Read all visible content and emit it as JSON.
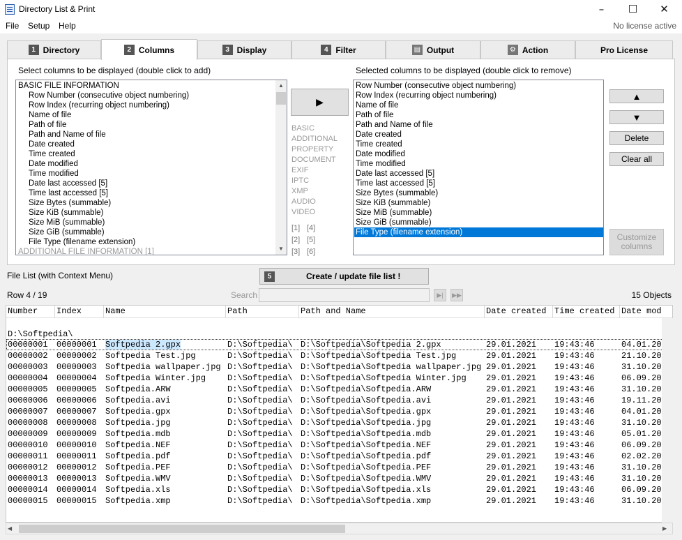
{
  "window": {
    "title": "Directory List & Print",
    "minimize": "–",
    "maximize": "☐",
    "close": "✕"
  },
  "menu": {
    "items": [
      "File",
      "Setup",
      "Help"
    ],
    "license_status": "No license active"
  },
  "tabs": [
    {
      "num": "1",
      "label": "Directory",
      "icon": "number-badge"
    },
    {
      "num": "2",
      "label": "Columns",
      "icon": "number-badge"
    },
    {
      "num": "3",
      "label": "Display",
      "icon": "number-badge"
    },
    {
      "num": "4",
      "label": "Filter",
      "icon": "number-badge"
    },
    {
      "num": "▤",
      "label": "Output",
      "icon": "output-icon"
    },
    {
      "num": "⚙",
      "label": "Action",
      "icon": "gear-icon"
    },
    {
      "num": "",
      "label": "Pro License",
      "icon": ""
    }
  ],
  "columns": {
    "available_caption": "Select columns to be displayed (double click to add)",
    "selected_caption": "Selected columns to be displayed (double click to remove)",
    "available": [
      {
        "text": "BASIC FILE INFORMATION",
        "type": "header"
      },
      {
        "text": "Row Number  (consecutive object numbering)",
        "type": "item"
      },
      {
        "text": "Row Index  (recurring object numbering)",
        "type": "item"
      },
      {
        "text": "Name of file",
        "type": "item"
      },
      {
        "text": "Path of file",
        "type": "item"
      },
      {
        "text": "Path and Name of file",
        "type": "item"
      },
      {
        "text": "Date created",
        "type": "item"
      },
      {
        "text": "Time created",
        "type": "item"
      },
      {
        "text": "Date modified",
        "type": "item"
      },
      {
        "text": "Time modified",
        "type": "item"
      },
      {
        "text": "Date last accessed [5]",
        "type": "item"
      },
      {
        "text": "Time last accessed [5]",
        "type": "item"
      },
      {
        "text": "Size Bytes  (summable)",
        "type": "item"
      },
      {
        "text": "Size KiB  (summable)",
        "type": "item"
      },
      {
        "text": "Size MiB  (summable)",
        "type": "item"
      },
      {
        "text": "Size GiB  (summable)",
        "type": "item"
      },
      {
        "text": "File Type  (filename extension)",
        "type": "item"
      },
      {
        "text": "ADDITIONAL FILE INFORMATION [1]",
        "type": "dim"
      }
    ],
    "selected": [
      "Row Number  (consecutive object numbering)",
      "Row Index  (recurring object numbering)",
      "Name of file",
      "Path of file",
      "Path and Name of file",
      "Date created",
      "Time created",
      "Date modified",
      "Time modified",
      "Date last accessed [5]",
      "Time last accessed [5]",
      "Size Bytes  (summable)",
      "Size KiB  (summable)",
      "Size MiB  (summable)",
      "Size GiB  (summable)",
      "File Type  (filename extension)"
    ],
    "selected_index": 15,
    "add_button": "▶",
    "categories": [
      "BASIC",
      "ADDITIONAL",
      "PROPERTY",
      "DOCUMENT",
      "EXIF",
      "IPTC",
      "XMP",
      "AUDIO",
      "VIDEO"
    ],
    "page_refs": [
      [
        "[1]",
        "[4]"
      ],
      [
        "[2]",
        "[5]"
      ],
      [
        "[3]",
        "[6]"
      ]
    ],
    "up_button": "▲",
    "down_button": "▼",
    "delete_button": "Delete",
    "clear_button": "Clear all",
    "customize_button": "Customize columns"
  },
  "file_list": {
    "caption": "File List (with Context Menu)",
    "create_num": "5",
    "create_button": "Create / update file list !",
    "row_status": "Row 4 / 19",
    "search_label": "Search",
    "search_value": "",
    "objects_count": "15 Objects",
    "headers": [
      "Number",
      "Index",
      "Name",
      "Path",
      "Path and Name",
      "Date created",
      "Time created",
      "Date mod"
    ],
    "group_label": "D:\\Softpedia\\",
    "current_row": 0,
    "rows": [
      [
        "00000001",
        "00000001",
        "Softpedia 2.gpx",
        "D:\\Softpedia\\",
        "D:\\Softpedia\\Softpedia 2.gpx",
        "29.01.2021",
        "19:43:46",
        "04.01.20"
      ],
      [
        "00000002",
        "00000002",
        "Softpedia Test.jpg",
        "D:\\Softpedia\\",
        "D:\\Softpedia\\Softpedia Test.jpg",
        "29.01.2021",
        "19:43:46",
        "21.10.20"
      ],
      [
        "00000003",
        "00000003",
        "Softpedia wallpaper.jpg",
        "D:\\Softpedia\\",
        "D:\\Softpedia\\Softpedia wallpaper.jpg",
        "29.01.2021",
        "19:43:46",
        "31.10.20"
      ],
      [
        "00000004",
        "00000004",
        "Softpedia Winter.jpg",
        "D:\\Softpedia\\",
        "D:\\Softpedia\\Softpedia Winter.jpg",
        "29.01.2021",
        "19:43:46",
        "06.09.20"
      ],
      [
        "00000005",
        "00000005",
        "Softpedia.ARW",
        "D:\\Softpedia\\",
        "D:\\Softpedia\\Softpedia.ARW",
        "29.01.2021",
        "19:43:46",
        "31.10.20"
      ],
      [
        "00000006",
        "00000006",
        "Softpedia.avi",
        "D:\\Softpedia\\",
        "D:\\Softpedia\\Softpedia.avi",
        "29.01.2021",
        "19:43:46",
        "19.11.20"
      ],
      [
        "00000007",
        "00000007",
        "Softpedia.gpx",
        "D:\\Softpedia\\",
        "D:\\Softpedia\\Softpedia.gpx",
        "29.01.2021",
        "19:43:46",
        "04.01.20"
      ],
      [
        "00000008",
        "00000008",
        "Softpedia.jpg",
        "D:\\Softpedia\\",
        "D:\\Softpedia\\Softpedia.jpg",
        "29.01.2021",
        "19:43:46",
        "31.10.20"
      ],
      [
        "00000009",
        "00000009",
        "Softpedia.mdb",
        "D:\\Softpedia\\",
        "D:\\Softpedia\\Softpedia.mdb",
        "29.01.2021",
        "19:43:46",
        "05.01.20"
      ],
      [
        "00000010",
        "00000010",
        "Softpedia.NEF",
        "D:\\Softpedia\\",
        "D:\\Softpedia\\Softpedia.NEF",
        "29.01.2021",
        "19:43:46",
        "06.09.20"
      ],
      [
        "00000011",
        "00000011",
        "Softpedia.pdf",
        "D:\\Softpedia\\",
        "D:\\Softpedia\\Softpedia.pdf",
        "29.01.2021",
        "19:43:46",
        "02.02.20"
      ],
      [
        "00000012",
        "00000012",
        "Softpedia.PEF",
        "D:\\Softpedia\\",
        "D:\\Softpedia\\Softpedia.PEF",
        "29.01.2021",
        "19:43:46",
        "31.10.20"
      ],
      [
        "00000013",
        "00000013",
        "Softpedia.WMV",
        "D:\\Softpedia\\",
        "D:\\Softpedia\\Softpedia.WMV",
        "29.01.2021",
        "19:43:46",
        "31.10.20"
      ],
      [
        "00000014",
        "00000014",
        "Softpedia.xls",
        "D:\\Softpedia\\",
        "D:\\Softpedia\\Softpedia.xls",
        "29.01.2021",
        "19:43:46",
        "06.09.20"
      ],
      [
        "00000015",
        "00000015",
        "Softpedia.xmp",
        "D:\\Softpedia\\",
        "D:\\Softpedia\\Softpedia.xmp",
        "29.01.2021",
        "19:43:46",
        "31.10.20"
      ]
    ]
  },
  "colors": {
    "selection": "#0078d7",
    "highlight": "#cce8ff",
    "panel": "#ffffff",
    "background": "#f0f0f0"
  }
}
